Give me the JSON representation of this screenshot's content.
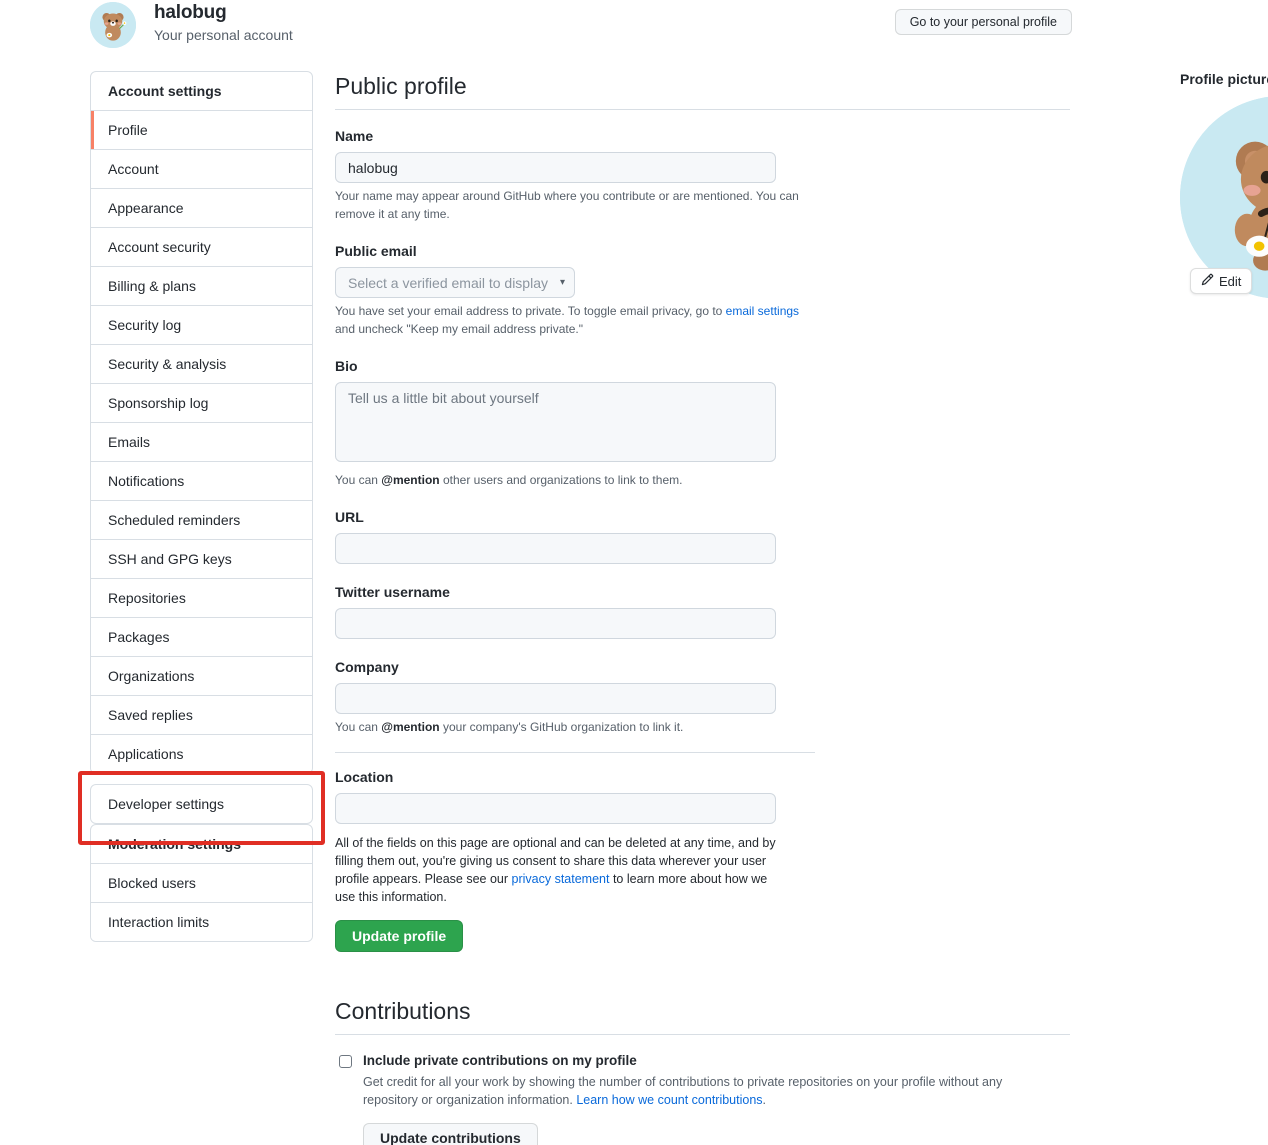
{
  "header": {
    "username": "halobug",
    "subtitle": "Your personal account",
    "goto_profile_label": "Go to your personal profile",
    "avatar_name": "bear-avatar"
  },
  "sidebar": {
    "account_group": {
      "heading": "Account settings",
      "items": [
        {
          "label": "Profile",
          "selected": true
        },
        {
          "label": "Account",
          "selected": false
        },
        {
          "label": "Appearance",
          "selected": false
        },
        {
          "label": "Account security",
          "selected": false
        },
        {
          "label": "Billing & plans",
          "selected": false
        },
        {
          "label": "Security log",
          "selected": false
        },
        {
          "label": "Security & analysis",
          "selected": false
        },
        {
          "label": "Sponsorship log",
          "selected": false
        },
        {
          "label": "Emails",
          "selected": false
        },
        {
          "label": "Notifications",
          "selected": false
        },
        {
          "label": "Scheduled reminders",
          "selected": false
        },
        {
          "label": "SSH and GPG keys",
          "selected": false
        },
        {
          "label": "Repositories",
          "selected": false
        },
        {
          "label": "Packages",
          "selected": false
        },
        {
          "label": "Organizations",
          "selected": false
        },
        {
          "label": "Saved replies",
          "selected": false
        },
        {
          "label": "Applications",
          "selected": false
        }
      ]
    },
    "developer_settings_label": "Developer settings",
    "moderation_group": {
      "heading": "Moderation settings",
      "items": [
        {
          "label": "Blocked users"
        },
        {
          "label": "Interaction limits"
        }
      ]
    }
  },
  "main": {
    "title": "Public profile",
    "name": {
      "label": "Name",
      "value": "halobug",
      "hint_1": "Your name may appear around GitHub where you contribute or are mentioned. You can remove it at any time."
    },
    "public_email": {
      "label": "Public email",
      "selected_option": "Select a verified email to display",
      "hint_prefix": "You have set your email address to private. To toggle email privacy, go to ",
      "hint_link": "email settings",
      "hint_suffix": " and uncheck \"Keep my email address private.\""
    },
    "bio": {
      "label": "Bio",
      "placeholder": "Tell us a little bit about yourself",
      "value": "",
      "hint_prefix": "You can ",
      "hint_bold": "@mention",
      "hint_suffix": " other users and organizations to link to them."
    },
    "url": {
      "label": "URL",
      "value": ""
    },
    "twitter": {
      "label": "Twitter username",
      "value": ""
    },
    "company": {
      "label": "Company",
      "value": "",
      "hint_prefix": "You can ",
      "hint_bold": "@mention",
      "hint_suffix": " your company's GitHub organization to link it."
    },
    "location": {
      "label": "Location",
      "value": ""
    },
    "legal": {
      "prefix": "All of the fields on this page are optional and can be deleted at any time, and by filling them out, you're giving us consent to share this data wherever your user profile appears. Please see our ",
      "link": "privacy statement",
      "suffix": " to learn more about how we use this information."
    },
    "update_profile_label": "Update profile"
  },
  "profile_picture": {
    "label": "Profile picture",
    "edit_label": "Edit",
    "avatar_name": "bear-avatar",
    "background_color": "#c9e9f2"
  },
  "contributions": {
    "title": "Contributions",
    "checkbox_label": "Include private contributions on my profile",
    "checkbox_checked": false,
    "desc_prefix": "Get credit for all your work by showing the number of contributions to private repositories on your profile without any repository or organization information. ",
    "desc_link": "Learn how we count contributions",
    "desc_suffix": ".",
    "update_label": "Update contributions"
  },
  "colors": {
    "accent_link": "#0969da",
    "active_indicator": "#f78166",
    "primary_button": "#2da44e",
    "annotation_box": "#e02e24"
  }
}
